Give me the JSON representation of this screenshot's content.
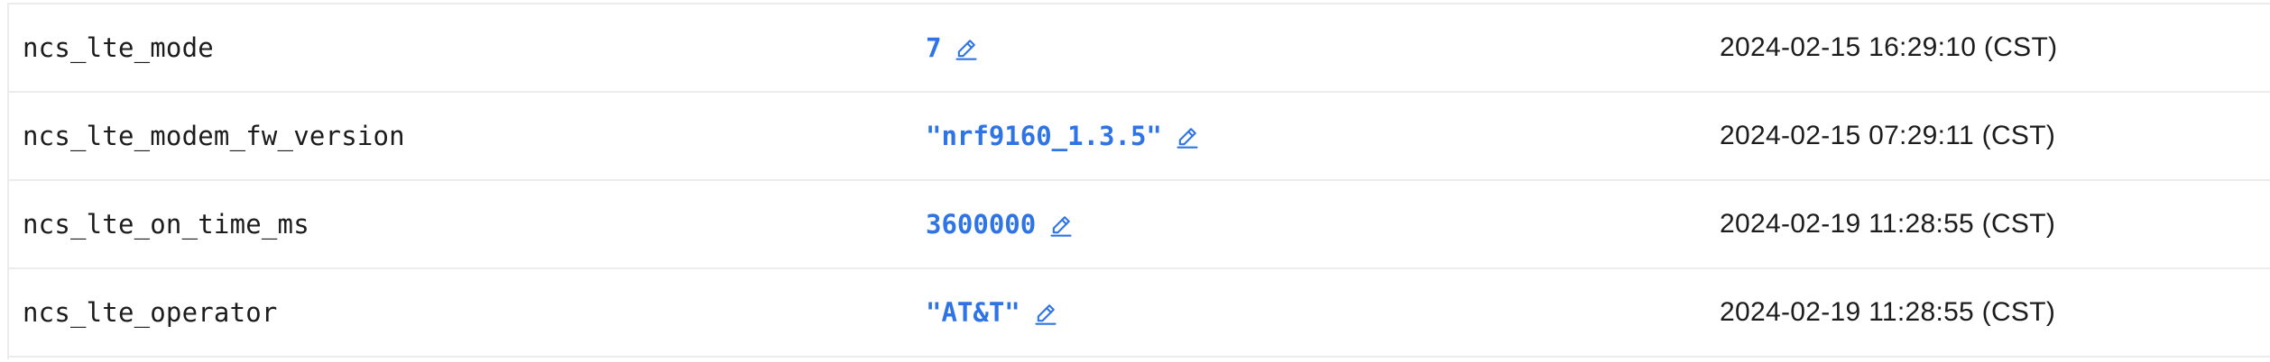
{
  "colors": {
    "value": "#2e74e6",
    "text": "#1c1c1e",
    "border": "#ececef"
  },
  "rows": [
    {
      "key": "ncs_lte_mode",
      "value": "7",
      "updated": "2024-02-15 16:29:10 (CST)",
      "edit_icon": "pencil-icon"
    },
    {
      "key": "ncs_lte_modem_fw_version",
      "value": "\"nrf9160_1.3.5\"",
      "updated": "2024-02-15 07:29:11 (CST)",
      "edit_icon": "pencil-icon"
    },
    {
      "key": "ncs_lte_on_time_ms",
      "value": "3600000",
      "updated": "2024-02-19 11:28:55 (CST)",
      "edit_icon": "pencil-icon"
    },
    {
      "key": "ncs_lte_operator",
      "value": "\"AT&T\"",
      "updated": "2024-02-19 11:28:55 (CST)",
      "edit_icon": "pencil-icon"
    }
  ]
}
